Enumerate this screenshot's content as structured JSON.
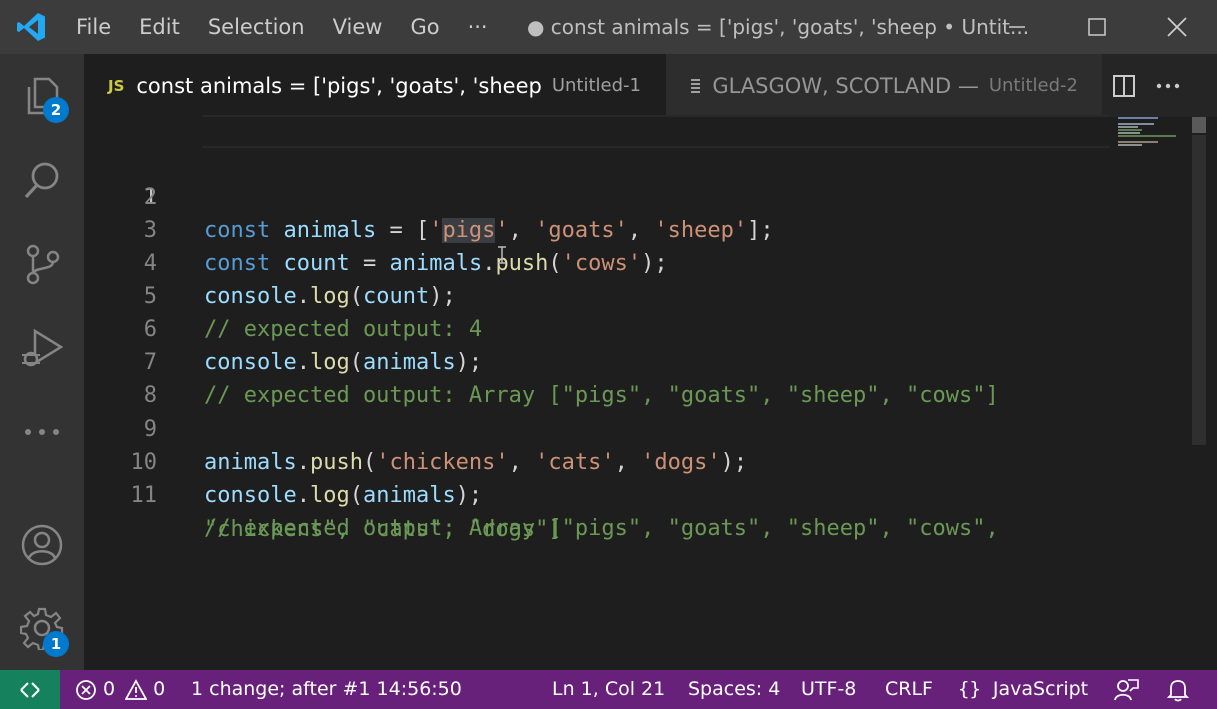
{
  "titlebar": {
    "menu": [
      "File",
      "Edit",
      "Selection",
      "View",
      "Go",
      "···"
    ],
    "window_title": "● const animals = ['pigs', 'goats', 'sheep • Untit..."
  },
  "activity": {
    "explorer_badge": "2",
    "settings_badge": "1"
  },
  "tabs": [
    {
      "icon": "JS",
      "label": "const animals = ['pigs', 'goats', 'sheep",
      "description": "Untitled-1",
      "dirty": true
    },
    {
      "icon": "text-lines-icon",
      "label": "GLASGOW, SCOTLAND —",
      "description": "Untitled-2",
      "dirty": false
    }
  ],
  "editor": {
    "lines": [
      {
        "n": "1"
      },
      {
        "n": "2"
      },
      {
        "n": "3"
      },
      {
        "n": "4"
      },
      {
        "n": "5"
      },
      {
        "n": "6"
      },
      {
        "n": "7"
      },
      {
        "n": "8"
      },
      {
        "n": "9"
      },
      {
        "n": "10"
      },
      {
        "n": "11"
      }
    ],
    "code": {
      "l1_kw": "const",
      "l1_var": "animals",
      "l1_eq": " = [",
      "l1_q1": "'",
      "l1_sel": "pigs",
      "l1_s1": "'",
      "l1_p1": ", ",
      "l1_s2": "'goats'",
      "l1_p2": ", ",
      "l1_s3": "'sheep'",
      "l1_end": "];",
      "l3_kw": "const",
      "l3_var": "count",
      "l3_eq": " = ",
      "l3_obj": "animals",
      "l3_dot": ".",
      "l3_fn": "push",
      "l3_open": "(",
      "l3_str": "'cows'",
      "l3_end": ");",
      "l4_obj": "console",
      "l4_dot": ".",
      "l4_fn": "log",
      "l4_open": "(",
      "l4_arg": "count",
      "l4_end": ");",
      "l5_cmt": "// expected output: 4",
      "l6_obj": "console",
      "l6_dot": ".",
      "l6_fn": "log",
      "l6_open": "(",
      "l6_arg": "animals",
      "l6_end": ");",
      "l7_cmt": "// expected output: Array [\"pigs\", \"goats\", \"sheep\", \"cows\"]",
      "l9_obj": "animals",
      "l9_dot": ".",
      "l9_fn": "push",
      "l9_open": "(",
      "l9_s1": "'chickens'",
      "l9_p1": ", ",
      "l9_s2": "'cats'",
      "l9_p2": ", ",
      "l9_s3": "'dogs'",
      "l9_end": ");",
      "l10_obj": "console",
      "l10_dot": ".",
      "l10_fn": "log",
      "l10_open": "(",
      "l10_arg": "animals",
      "l10_end": ");",
      "l11_cmt": "// expected output: Array [\"pigs\", \"goats\", \"sheep\", \"cows\",",
      "l11_wrap": "\"chickens\", \"cats\", \"dogs\"]"
    }
  },
  "statusbar": {
    "errors": "0",
    "warnings": "0",
    "change_info": "1 change; after #1  14:56:50",
    "position": "Ln 1, Col 21",
    "spaces": "Spaces: 4",
    "encoding": "UTF-8",
    "eol": "CRLF",
    "language": "JavaScript"
  },
  "colors": {
    "statusbar": "#68217a",
    "remote": "#16825d",
    "badge": "#007acc",
    "keyword": "#569cd6",
    "variable": "#9cdcfe",
    "function": "#dcdcaa",
    "string": "#ce9178",
    "comment": "#6a9955"
  }
}
